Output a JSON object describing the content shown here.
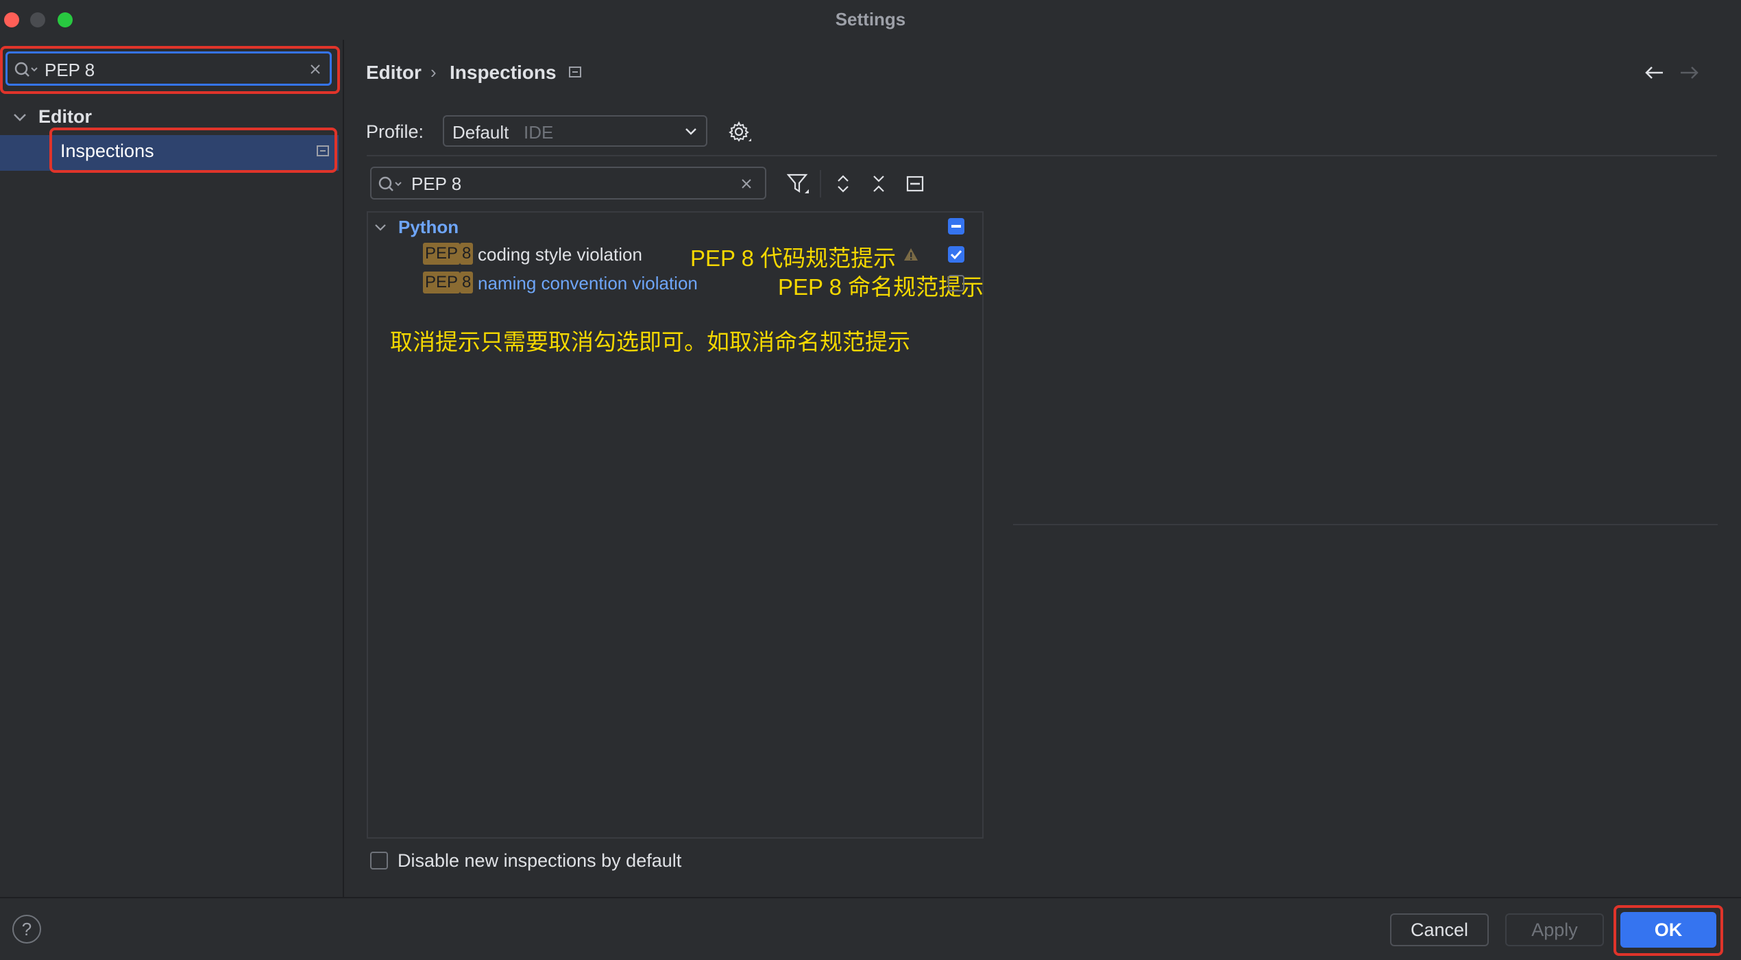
{
  "window": {
    "title": "Settings"
  },
  "sidebar": {
    "search_value": "PEP 8",
    "tree": [
      {
        "label": "Editor"
      },
      {
        "label": "Inspections"
      }
    ]
  },
  "breadcrumb": {
    "parent": "Editor",
    "current": "Inspections"
  },
  "profile": {
    "label": "Profile:",
    "value": "Default",
    "scope": "IDE"
  },
  "filter": {
    "value": "PEP 8"
  },
  "inspections": {
    "group": "Python",
    "items": [
      {
        "badge1": "PEP",
        "badge2": "8",
        "name": "coding style violation",
        "note": "PEP 8 代码规范提示",
        "checked": true
      },
      {
        "badge1": "PEP",
        "badge2": "8",
        "name": "naming convention violation",
        "note": "PEP 8 命名规范提示",
        "checked": false
      }
    ],
    "annotation": "取消提示只需要取消勾选即可。如取消命名规范提示"
  },
  "options": {
    "disable_new_label": "Disable new inspections by default"
  },
  "footer": {
    "help": "?",
    "cancel": "Cancel",
    "apply": "Apply",
    "ok": "OK"
  },
  "colors": {
    "accent": "#3574f0",
    "highlight_box": "#e0342a",
    "annotation_text": "#f5d800",
    "link_text": "#6ea5f8"
  }
}
